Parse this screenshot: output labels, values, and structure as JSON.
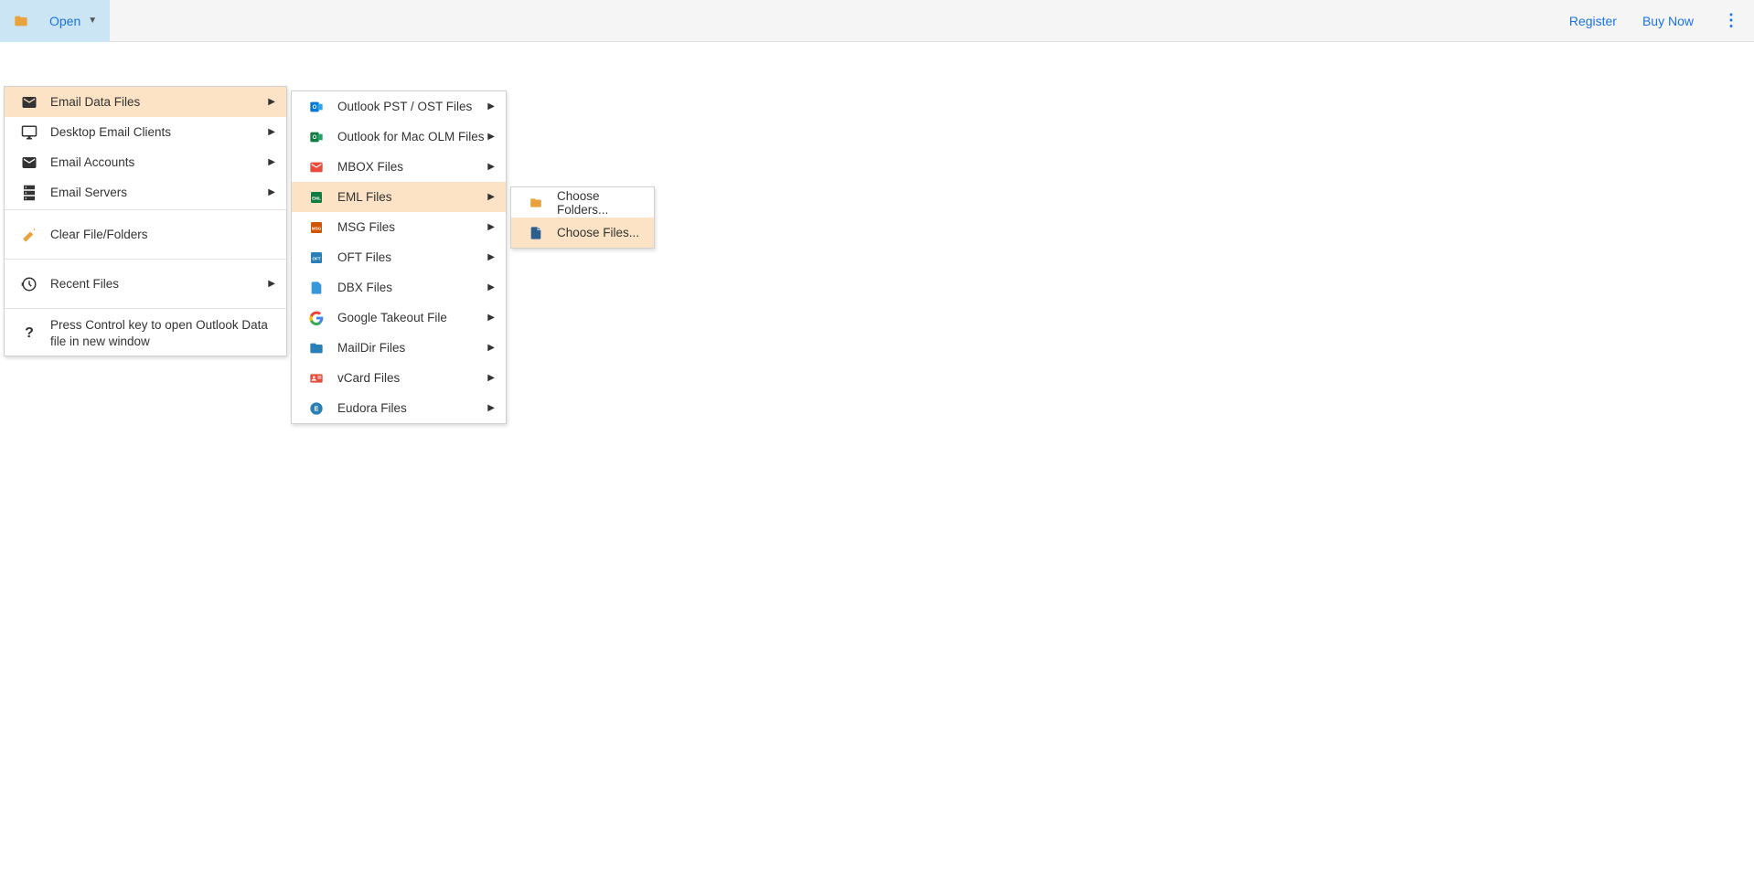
{
  "toolbar": {
    "open_label": "Open",
    "register_label": "Register",
    "buynow_label": "Buy Now"
  },
  "menu1": {
    "items": [
      {
        "label": "Email Data Files",
        "has_submenu": true,
        "highlighted": true,
        "icon": "envelope-stack"
      },
      {
        "label": "Desktop Email Clients",
        "has_submenu": true,
        "highlighted": false,
        "icon": "desktop"
      },
      {
        "label": "Email Accounts",
        "has_submenu": true,
        "highlighted": false,
        "icon": "envelope"
      },
      {
        "label": "Email Servers",
        "has_submenu": true,
        "highlighted": false,
        "icon": "server"
      }
    ],
    "clear_label": "Clear File/Folders",
    "recent_label": "Recent Files",
    "help_text": "Press Control key to open Outlook Data file in new window"
  },
  "menu2": {
    "items": [
      {
        "label": "Outlook PST / OST Files",
        "highlighted": false,
        "icon": "outlook"
      },
      {
        "label": "Outlook for Mac OLM Files",
        "highlighted": false,
        "icon": "olm"
      },
      {
        "label": "MBOX Files",
        "highlighted": false,
        "icon": "mbox"
      },
      {
        "label": "EML Files",
        "highlighted": true,
        "icon": "eml"
      },
      {
        "label": "MSG Files",
        "highlighted": false,
        "icon": "msg"
      },
      {
        "label": "OFT Files",
        "highlighted": false,
        "icon": "oft"
      },
      {
        "label": "DBX Files",
        "highlighted": false,
        "icon": "dbx"
      },
      {
        "label": "Google Takeout File",
        "highlighted": false,
        "icon": "google"
      },
      {
        "label": "MailDir Files",
        "highlighted": false,
        "icon": "maildir"
      },
      {
        "label": "vCard Files",
        "highlighted": false,
        "icon": "vcard"
      },
      {
        "label": "Eudora Files",
        "highlighted": false,
        "icon": "eudora"
      }
    ]
  },
  "menu3": {
    "items": [
      {
        "label": "Choose Folders...",
        "highlighted": false,
        "icon": "folder"
      },
      {
        "label": "Choose Files...",
        "highlighted": true,
        "icon": "file"
      }
    ]
  }
}
